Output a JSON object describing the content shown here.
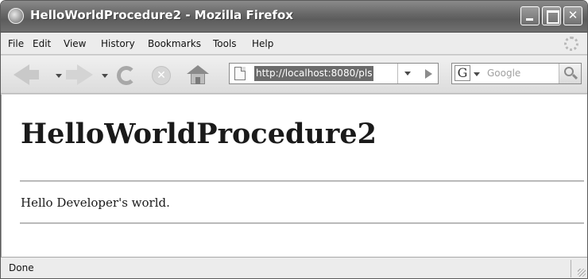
{
  "window": {
    "title": "HelloWorldProcedure2 - Mozilla Firefox"
  },
  "menubar": {
    "items": [
      {
        "label": "File"
      },
      {
        "label": "Edit"
      },
      {
        "label": "View"
      },
      {
        "label": "History"
      },
      {
        "label": "Bookmarks"
      },
      {
        "label": "Tools"
      },
      {
        "label": "Help"
      }
    ]
  },
  "toolbar": {
    "url": "http://localhost:8080/pls",
    "search_engine_icon": "G",
    "search_placeholder": "Google",
    "icons": [
      "back-icon",
      "forward-icon",
      "reload-icon",
      "stop-icon",
      "home-icon",
      "page-icon",
      "go-icon",
      "search-icon"
    ]
  },
  "page": {
    "heading": "HelloWorldProcedure2",
    "message": "Hello Developer's world."
  },
  "status": {
    "text": "Done"
  }
}
